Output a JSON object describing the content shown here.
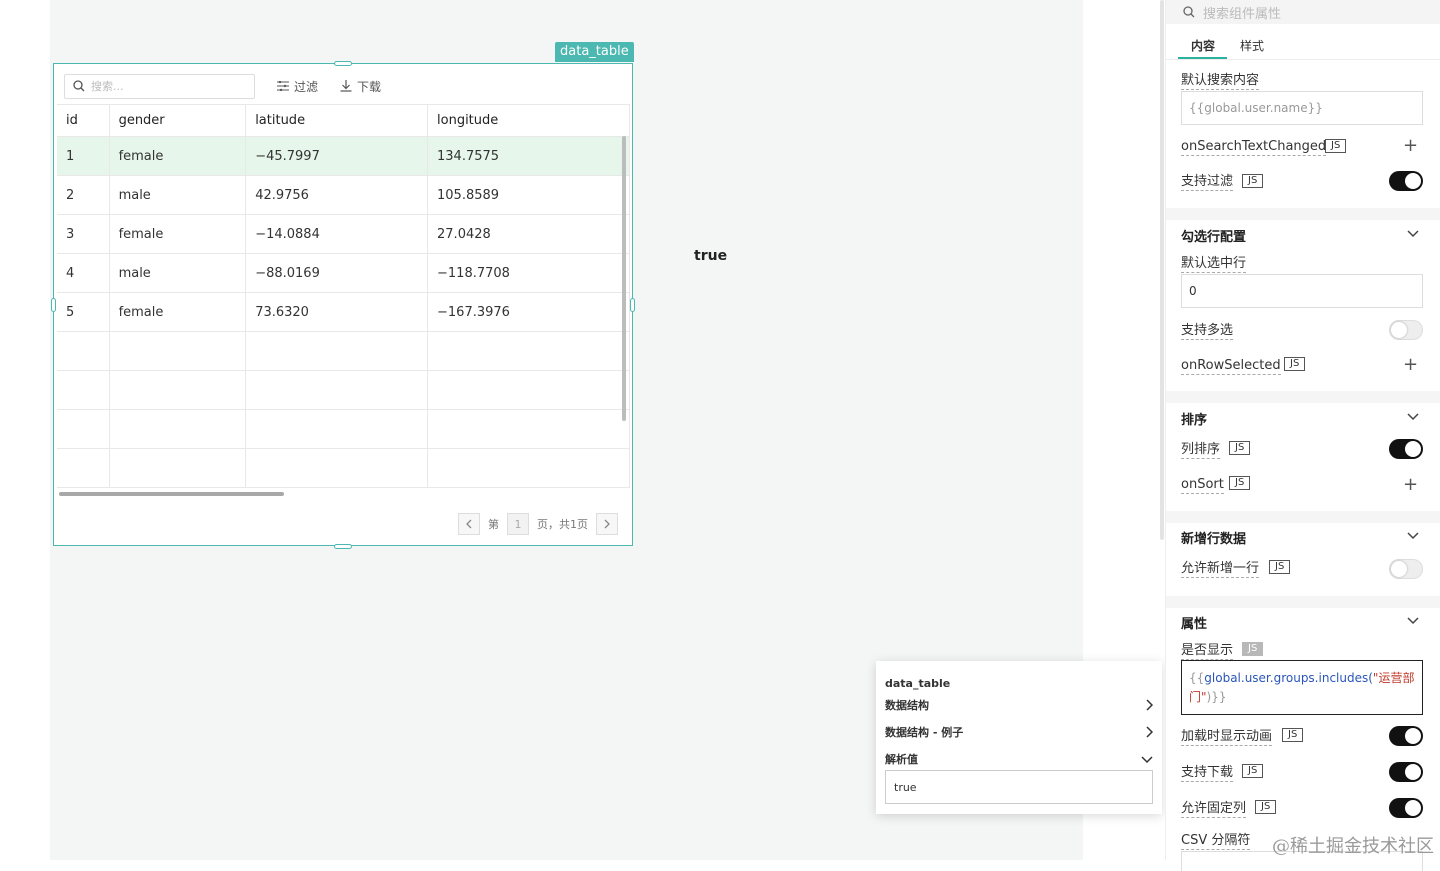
{
  "component_tag": "data_table",
  "table": {
    "search_placeholder": "搜索...",
    "filter_label": "过滤",
    "download_label": "下载",
    "columns": [
      "id",
      "gender",
      "latitude",
      "longitude"
    ],
    "rows": [
      [
        "1",
        "female",
        "−45.7997",
        "134.7575"
      ],
      [
        "2",
        "male",
        "42.9756",
        "105.8589"
      ],
      [
        "3",
        "female",
        "−14.0884",
        "27.0428"
      ],
      [
        "4",
        "male",
        "−88.0169",
        "−118.7708"
      ],
      [
        "5",
        "female",
        "73.6320",
        "−167.3976"
      ]
    ],
    "selected_row_index": 0,
    "pager": {
      "prefix": "第",
      "page": "1",
      "suffix": "页，共1页"
    }
  },
  "canvas_text": "true",
  "popup": {
    "title": "data_table",
    "items": [
      {
        "label": "数据结构",
        "icon": "chevron-right-icon"
      },
      {
        "label": "数据结构 - 例子",
        "icon": "chevron-right-icon"
      },
      {
        "label": "解析值",
        "icon": "chevron-down-icon"
      }
    ],
    "value": "true"
  },
  "panel": {
    "search_placeholder": "搜索组件属性",
    "tabs": [
      "内容",
      "样式"
    ],
    "default_search_label": "默认搜索内容",
    "default_search_value": "{{global.user.name}}",
    "on_search_text_changed": "onSearchTextChanged",
    "support_filter": "支持过滤",
    "row_select_section": "勾选行配置",
    "default_selected_row": "默认选中行",
    "default_selected_value": "0",
    "multi_select": "支持多选",
    "on_row_selected": "onRowSelected",
    "sort_section": "排序",
    "column_sort": "列排序",
    "on_sort": "onSort",
    "new_row_section": "新增行数据",
    "allow_new_row": "允许新增一行",
    "attr_section": "属性",
    "visible_label": "是否显示",
    "visible_code": {
      "open": "{{",
      "var": "global.user.groups.includes(",
      "str": "\"运营部门\"",
      "close": ")}}"
    },
    "loading_anim": "加载时显示动画",
    "support_download": "支持下载",
    "allow_fixed_col": "允许固定列",
    "csv_sep": "CSV 分隔符",
    "js_badge": "JS",
    "toggles": {
      "support_filter": true,
      "multi_select": false,
      "column_sort": true,
      "allow_new_row": false,
      "loading_anim": true,
      "support_download": true,
      "allow_fixed_col": true
    }
  },
  "watermark": "@稀土掘金技术社区",
  "colors": {
    "accent": "#4bb8b1",
    "selected_row": "#e6f6ea",
    "tab_underline": "#2bb3a0"
  }
}
